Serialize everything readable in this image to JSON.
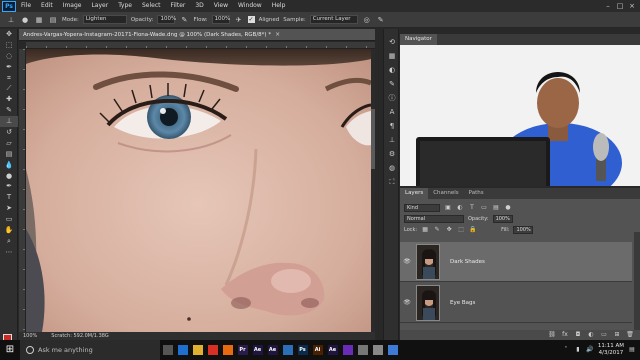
{
  "app": {
    "logo_text": "Ps"
  },
  "menu": [
    "File",
    "Edit",
    "Image",
    "Layer",
    "Type",
    "Select",
    "Filter",
    "3D",
    "View",
    "Window",
    "Help"
  ],
  "options_bar": {
    "mode_label": "Mode:",
    "mode_value": "Lighten",
    "opacity_label": "Opacity:",
    "opacity_value": "100%",
    "flow_label": "Flow:",
    "flow_value": "100%",
    "aligned_label": "Aligned",
    "sample_label": "Sample:",
    "sample_value": "Current Layer"
  },
  "document": {
    "tab_title": "Andres-Vargas-Yopera-Instagram-20171-Fiona-Wade.dng @ 100% (Dark Shades, RGB/8*) *",
    "close_glyph": "×",
    "status_zoom": "100%",
    "status_scratch": "Scratch: 592.0M/1.38G"
  },
  "navigator": {
    "tab_label": "Navigator"
  },
  "layers_panel": {
    "tabs": [
      "Layers",
      "Channels",
      "Paths"
    ],
    "kind_label": "Kind",
    "blend_mode": "Normal",
    "opacity_label": "Opacity:",
    "opacity_value": "100%",
    "lock_label": "Lock:",
    "fill_label": "Fill:",
    "fill_value": "100%",
    "layers": [
      {
        "name": "Dark Shades",
        "selected": true
      },
      {
        "name": "Eye Bags",
        "selected": false
      }
    ]
  },
  "taskbar": {
    "search_placeholder": "Ask me anything",
    "apps": [
      {
        "label": "",
        "color": "#555555"
      },
      {
        "label": "",
        "color": "#1f6fd1"
      },
      {
        "label": "",
        "color": "#e0b030"
      },
      {
        "label": "",
        "color": "#d93025"
      },
      {
        "label": "",
        "color": "#e86a10"
      },
      {
        "label": "Pr",
        "color": "#2a1b4d"
      },
      {
        "label": "Ae",
        "color": "#1f1540"
      },
      {
        "label": "Ae",
        "color": "#1f1540"
      },
      {
        "label": "",
        "color": "#2b6fb8"
      },
      {
        "label": "Ps",
        "color": "#0b2b4d"
      },
      {
        "label": "Ai",
        "color": "#4a2100"
      },
      {
        "label": "Ae",
        "color": "#1f1540"
      },
      {
        "label": "",
        "color": "#6a2bb8"
      },
      {
        "label": "",
        "color": "#777777"
      },
      {
        "label": "",
        "color": "#888888"
      },
      {
        "label": "",
        "color": "#3d7bd6"
      }
    ],
    "time": "11:11 AM",
    "date": "4/3/2017"
  }
}
